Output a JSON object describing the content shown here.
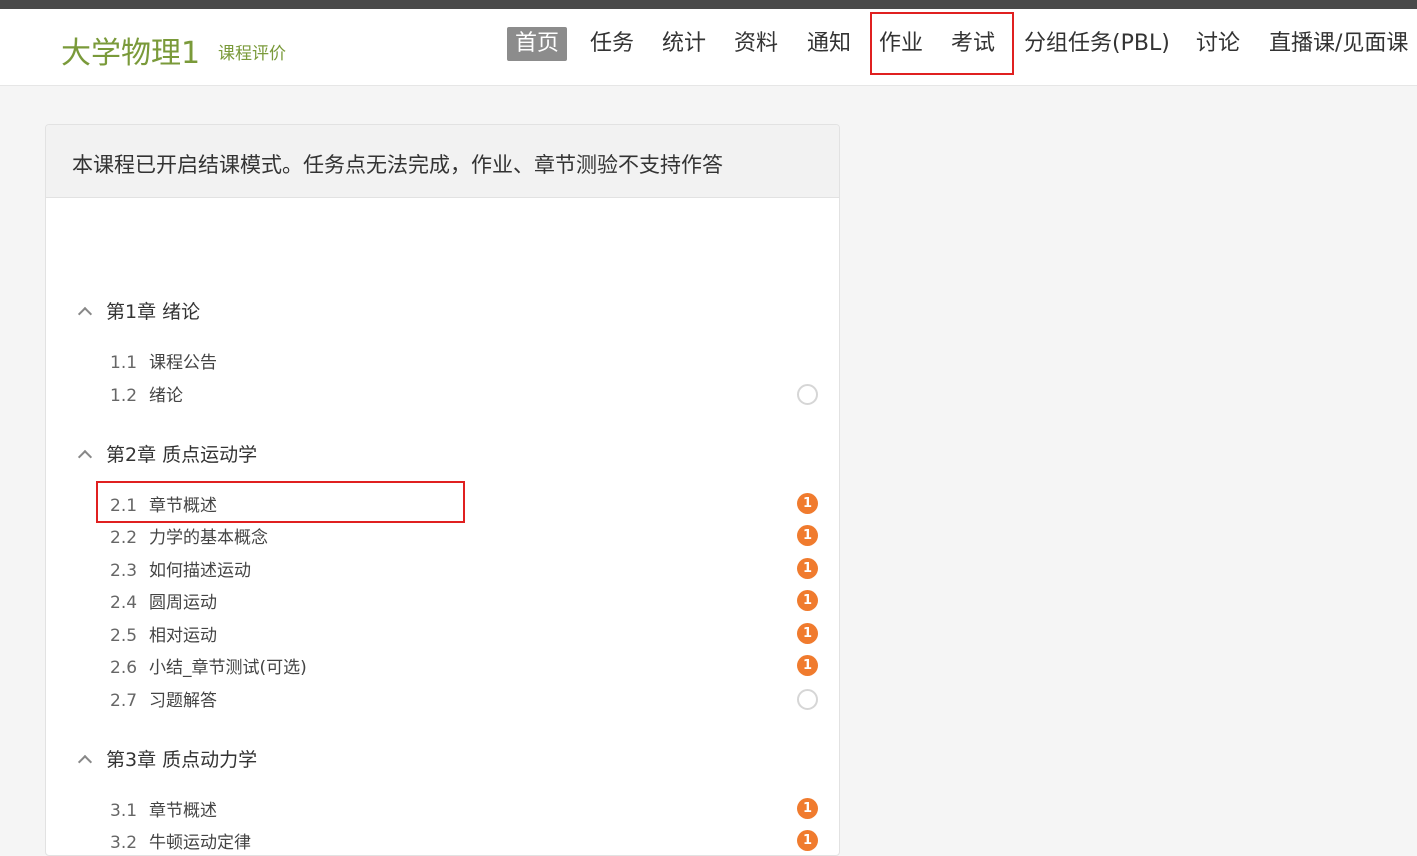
{
  "header": {
    "course_title": "大学物理1",
    "course_eval": "课程评价",
    "nav": [
      "首页",
      "任务",
      "统计",
      "资料",
      "通知",
      "作业",
      "考试",
      "分组任务(PBL)",
      "讨论",
      "直播课/见面课"
    ],
    "active_nav": "首页"
  },
  "notice": "本课程已开启结课模式。任务点无法完成，作业、章节测验不支持作答",
  "chapters": [
    {
      "title": "第1章 绪论",
      "sections": [
        {
          "num": "1.1",
          "title": "课程公告",
          "status": ""
        },
        {
          "num": "1.2",
          "title": "绪论",
          "status": "empty"
        }
      ]
    },
    {
      "title": "第2章 质点运动学",
      "sections": [
        {
          "num": "2.1",
          "title": "章节概述",
          "status": "1"
        },
        {
          "num": "2.2",
          "title": "力学的基本概念",
          "status": "1"
        },
        {
          "num": "2.3",
          "title": "如何描述运动",
          "status": "1"
        },
        {
          "num": "2.4",
          "title": "圆周运动",
          "status": "1"
        },
        {
          "num": "2.5",
          "title": "相对运动",
          "status": "1"
        },
        {
          "num": "2.6",
          "title": "小结_章节测试(可选)",
          "status": "1"
        },
        {
          "num": "2.7",
          "title": "习题解答",
          "status": "empty"
        }
      ]
    },
    {
      "title": "第3章 质点动力学",
      "sections": [
        {
          "num": "3.1",
          "title": "章节概述",
          "status": "1"
        },
        {
          "num": "3.2",
          "title": "牛顿运动定律",
          "status": "1"
        }
      ]
    }
  ],
  "colors": {
    "brand": "#7a9a3a",
    "badge": "#f07b2e",
    "highlight": "#e02020",
    "active_nav_bg": "#8c8c8c"
  }
}
